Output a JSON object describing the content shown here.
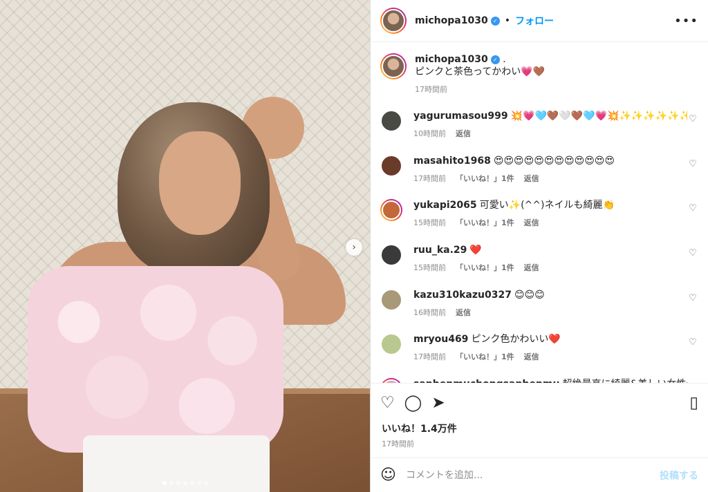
{
  "header": {
    "username": "michopa1030",
    "separator": "•",
    "follow_label": "フォロー",
    "more_icon": "…"
  },
  "caption": {
    "username": "michopa1030",
    "dot": ".",
    "text": "ピンクと茶色ってかわい💗🤎",
    "time": "17時間前"
  },
  "comments": [
    {
      "user": "yagurumasou999",
      "text": "💥💗🩵🤎🤍🤎🩵💗💥✨✨✨✨✨✨💐🍀🌿🫶",
      "time": "10時間前",
      "likes": "",
      "reply": "返信",
      "avatar_color": "#4a4a44",
      "ring": false
    },
    {
      "user": "masahito1968",
      "text": "😍😍😍😍😍😍😍😍😍😍😍😍",
      "time": "17時間前",
      "likes": "「いいね！」1件",
      "reply": "返信",
      "avatar_color": "#6b3b2a",
      "ring": false
    },
    {
      "user": "yukapi2065",
      "text": "可愛い✨(^^)ネイルも綺麗👏",
      "time": "15時間前",
      "likes": "「いいね！」1件",
      "reply": "返信",
      "avatar_color": "#c2683a",
      "ring": true
    },
    {
      "user": "ruu_ka.29",
      "text": "❤️",
      "time": "15時間前",
      "likes": "「いいね！」1件",
      "reply": "返信",
      "avatar_color": "#3a3a3a",
      "ring": false
    },
    {
      "user": "kazu310kazu0327",
      "text": "😊😊😊",
      "time": "16時間前",
      "likes": "",
      "reply": "返信",
      "avatar_color": "#a89a78",
      "ring": false
    },
    {
      "user": "mryou469",
      "text": "ピンク色かわいい❤️",
      "time": "17時間前",
      "likes": "「いいね！」1件",
      "reply": "返信",
      "avatar_color": "#b8c88e",
      "ring": false
    },
    {
      "user": "sanbenmuchongsanbenmu",
      "text": "超絶最高に綺麗&美しい女性セク",
      "time": "",
      "likes": "",
      "reply": "",
      "avatar_color": "#d8a8b8",
      "ring": true
    }
  ],
  "actions": {
    "like_icon": "♡",
    "comment_icon": "◯",
    "share_icon": "➤",
    "bookmark_icon": "▯"
  },
  "likes_text": "いいね！1.4万件",
  "post_time": "17時間前",
  "add_comment": {
    "emoji_icon": "☺",
    "placeholder": "コメントを追加...",
    "post_label": "投稿する"
  },
  "carousel": {
    "next_icon": "›",
    "slide_count": 7,
    "active_slide": 1
  }
}
